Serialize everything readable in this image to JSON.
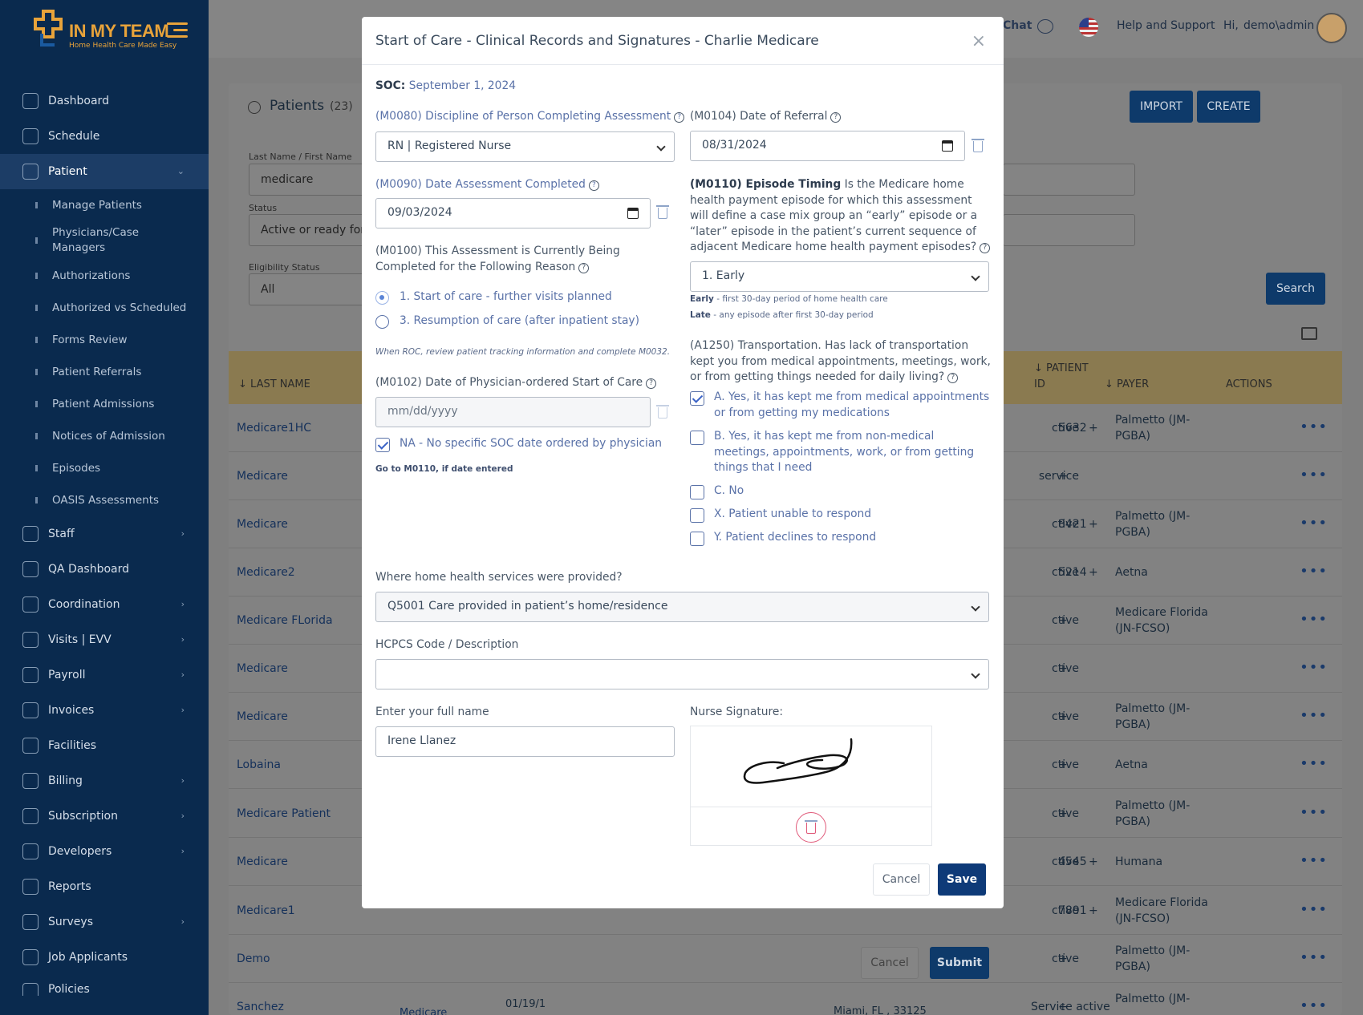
{
  "app": {
    "brand": "IN MY TEAM",
    "tagline": "Home Health Care Made Easy"
  },
  "sidebar": {
    "items": [
      {
        "label": "Dashboard"
      },
      {
        "label": "Schedule"
      },
      {
        "label": "Patient"
      },
      {
        "label": "Staff"
      },
      {
        "label": "QA Dashboard"
      },
      {
        "label": "Coordination"
      },
      {
        "label": "Visits | EVV"
      },
      {
        "label": "Payroll"
      },
      {
        "label": "Invoices"
      },
      {
        "label": "Facilities"
      },
      {
        "label": "Billing"
      },
      {
        "label": "Subscription"
      },
      {
        "label": "Developers"
      },
      {
        "label": "Reports"
      },
      {
        "label": "Surveys"
      },
      {
        "label": "Job Applicants"
      },
      {
        "label": "Policies"
      }
    ],
    "patient_sub": [
      "Manage Patients",
      "Physicians/Case Managers",
      "Authorizations",
      "Authorized vs Scheduled",
      "Forms Review",
      "Patient Referrals",
      "Patient Admissions",
      "Notices of Admission",
      "Episodes",
      "OASIS Assessments"
    ]
  },
  "topbar": {
    "chat": "Chat",
    "help": "Help and Support",
    "greeting": "Hi,",
    "user": "demo\\admin"
  },
  "patients_page": {
    "title": "Patients",
    "count": "(23)",
    "import": "IMPORT",
    "create": "CREATE",
    "name_label": "Last Name / First Name",
    "name_value": "medicare",
    "status_label": "Status",
    "status_value": "Active or ready for",
    "eligibility_label": "Eligibility Status",
    "eligibility_value": "All",
    "search": "Search",
    "columns": {
      "last_name": "↓ LAST NAME",
      "patient_id_1": "↓ PATIENT",
      "patient_id_2": "ID",
      "payer": "↓ PAYER",
      "actions": "ACTIONS"
    },
    "rows": [
      {
        "last": "Medicare1HC",
        "status": "ctive",
        "id": "5632",
        "payer": "Palmetto (JM-PGBA)"
      },
      {
        "last": "Medicare",
        "status": "service",
        "id": "",
        "payer": ""
      },
      {
        "last": "Medicare",
        "status": "ctive",
        "id": "8421",
        "payer": "Palmetto (JM-PGBA)"
      },
      {
        "last": "Medicare2",
        "status": "ctive",
        "id": "5214",
        "payer": "Aetna"
      },
      {
        "last": "Medicare FLorida",
        "status": "ctive",
        "id": "",
        "payer": "Medicare Florida (JN-FCSO)"
      },
      {
        "last": "Medicare",
        "status": "ctive",
        "id": "",
        "payer": ""
      },
      {
        "last": "Medicare",
        "status": "ctive",
        "id": "",
        "payer": "Palmetto (JM-PGBA)"
      },
      {
        "last": "Lobaina",
        "status": "ctive",
        "id": "",
        "payer": "Aetna"
      },
      {
        "last": "Medicare Patient",
        "status": "ctive",
        "id": "",
        "payer": "Palmetto (JM-PGBA)"
      },
      {
        "last": "Medicare",
        "status": "ctive",
        "id": "4545",
        "payer": "Humana"
      },
      {
        "last": "Medicare1",
        "status": "ctive",
        "id": "7891",
        "payer": "Medicare Florida (JN-FCSO)"
      },
      {
        "last": "Demo",
        "status": "ctive",
        "id": "",
        "payer": "Palmetto (JM-PGBA)"
      },
      {
        "last": "Sanchez",
        "status": "Service active",
        "id": "",
        "payer": "Palmetto (JM-"
      }
    ],
    "last_row_extra": {
      "payer_col": "Medicare",
      "date": "01/19/1",
      "location": "Miami, FL , 33125"
    },
    "behind_cancel": "Cancel",
    "behind_submit": "Submit"
  },
  "modal": {
    "title": "Start of Care - Clinical Records and Signatures - Charlie Medicare",
    "soc_label": "SOC:",
    "soc_value": "September 1, 2024",
    "m0080_label": "(M0080) Discipline of Person Completing Assessment",
    "m0080_value": "RN | Registered Nurse",
    "m0090_label": "(M0090) Date Assessment Completed",
    "m0090_value": "09/03/2024",
    "m0100_label": "(M0100) This Assessment is Currently Being Completed for the Following Reason",
    "m0100_opt1": "1. Start of care - further visits planned",
    "m0100_opt3": "3. Resumption of care (after inpatient stay)",
    "m0100_hint": "When ROC, review patient tracking information and complete M0032.",
    "m0102_label": "(M0102) Date of Physician-ordered Start of Care",
    "m0102_placeholder": "mm/dd/yyyy",
    "m0102_na": "NA - No specific SOC date ordered by physician",
    "m0102_note": "Go to M0110, if date entered",
    "m0104_label": "(M0104) Date of Referral",
    "m0104_value": "08/31/2024",
    "m0110_bold": "(M0110) Episode Timing",
    "m0110_text": "Is the Medicare home health payment episode for which this assessment will define a case mix group an “early” episode or a “later” episode in the patient’s current sequence of adjacent Medicare home health payment episodes?",
    "m0110_value": "1. Early",
    "early_bold": "Early",
    "early_text": "- first 30-day period of home health care",
    "late_bold": "Late",
    "late_text": "- any episode after first 30-day period",
    "a1250_label": "(A1250) Transportation. Has lack of transportation kept you from medical appointments, meetings, work, or from getting things needed for daily living?",
    "a1250_opts": [
      {
        "label": "A. Yes, it has kept me from medical appointments or from getting my medications",
        "checked": true
      },
      {
        "label": "B. Yes, it has kept me from non-medical meetings, appointments, work, or from getting things that I need",
        "checked": false
      },
      {
        "label": "C. No",
        "checked": false
      },
      {
        "label": "X. Patient unable to respond",
        "checked": false
      },
      {
        "label": "Y. Patient declines to respond",
        "checked": false
      }
    ],
    "where_label": "Where home health services were provided?",
    "where_value": "Q5001 Care provided in patient’s home/residence",
    "hcpcs_label": "HCPCS Code / Description",
    "hcpcs_value": "",
    "fullname_label": "Enter your full name",
    "fullname_value": "Irene Llanez",
    "signature_label": "Nurse Signature:",
    "cancel": "Cancel",
    "save": "Save"
  },
  "colors": {
    "sidebar_bg": "#0a2a4e",
    "primary": "#0e3a78",
    "brand_accent": "#e8a33a",
    "delete": "#e05a7a"
  }
}
